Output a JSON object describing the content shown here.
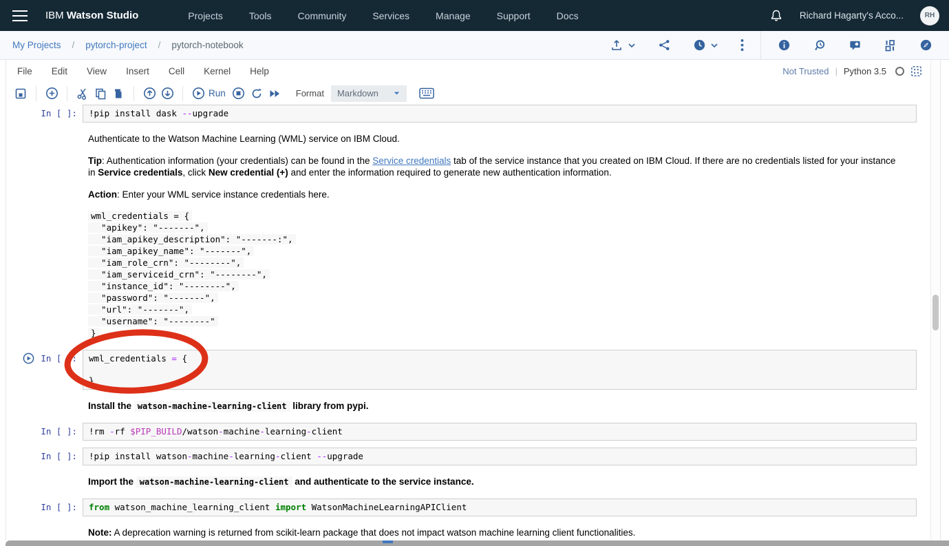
{
  "header": {
    "brand_prefix": "IBM",
    "brand_bold": "Watson Studio",
    "nav": [
      "Projects",
      "Tools",
      "Community",
      "Services",
      "Manage",
      "Support",
      "Docs"
    ],
    "account_name": "Richard Hagarty's Acco...",
    "avatar_initials": "RH",
    "icons": [
      "menu",
      "notifications"
    ]
  },
  "projectbar": {
    "breadcrumb": [
      {
        "label": "My Projects",
        "link": true
      },
      {
        "label": "pytorch-project",
        "link": true
      },
      {
        "label": "pytorch-notebook",
        "link": false
      }
    ],
    "separator": "/",
    "action_icons": [
      "upload",
      "share",
      "versions",
      "overflow-menu",
      "info",
      "history",
      "comments",
      "environment",
      "guide"
    ]
  },
  "menubar": {
    "items": [
      "File",
      "Edit",
      "View",
      "Insert",
      "Cell",
      "Kernel",
      "Help"
    ],
    "trust_label": "Not Trusted",
    "pipe": "|",
    "kernel_name": "Python 3.5",
    "status_icons": [
      "kernel-idle-circle",
      "kernel-busy-grid"
    ]
  },
  "toolbar": {
    "icons": [
      "save",
      "insert-cell",
      "cut",
      "copy",
      "paste",
      "move-up",
      "move-down",
      "run",
      "stop",
      "restart",
      "fast-forward",
      "keyboard"
    ],
    "run_label": "Run",
    "format_label": "Format",
    "format_value": "Markdown"
  },
  "colors": {
    "appbar_bg": "#152935",
    "icon_blue": "#35639f",
    "link_blue": "#4178be",
    "prompt_navy": "#303F9F",
    "operator_purple": "#AA22FF",
    "keyword_green": "#008000",
    "annotation_red": "#dd3018",
    "cell_bg": "#f7f7f7"
  },
  "notebook": {
    "blocks": [
      {
        "kind": "code",
        "prompt": "In [ ]:",
        "lines": [
          [
            {
              "t": "!pip install dask ",
              "s": "p"
            },
            {
              "t": "--",
              "s": "op"
            },
            {
              "t": "upgrade",
              "s": "p"
            }
          ]
        ]
      },
      {
        "kind": "md",
        "runs": [
          {
            "t": "Authenticate to the Watson Machine Learning (WML) service on IBM Cloud."
          }
        ]
      },
      {
        "kind": "md",
        "runs": [
          {
            "t": "Tip",
            "b": true
          },
          {
            "t": ": Authentication information (your credentials) can be found in the "
          },
          {
            "t": "Service credentials",
            "link": true
          },
          {
            "t": " tab of the service instance that you created on IBM Cloud. If there are no credentials listed for your instance in "
          },
          {
            "t": "Service credentials",
            "b": true
          },
          {
            "t": ", click "
          },
          {
            "t": "New credential (+)",
            "b": true
          },
          {
            "t": " and enter the information required to generate new authentication information."
          }
        ]
      },
      {
        "kind": "md",
        "runs": [
          {
            "t": "Action",
            "b": true
          },
          {
            "t": ": Enter your WML service instance credentials here."
          }
        ]
      },
      {
        "kind": "mdcode",
        "lines": [
          "wml_credentials = {",
          "  \"apikey\": \"-------\",",
          "  \"iam_apikey_description\": \"-------:\",",
          "  \"iam_apikey_name\": \"-------\",",
          "  \"iam_role_crn\": \"--------\",",
          "  \"iam_serviceid_crn\": \"--------\",",
          "  \"instance_id\": \"--------\",",
          "  \"password\": \"-------\",",
          "  \"url\": \"-------\",",
          "  \"username\": \"--------\"",
          "}"
        ]
      },
      {
        "kind": "code",
        "prompt": "In [ ]:",
        "circled": true,
        "runbtn": true,
        "lines": [
          [
            {
              "t": "wml_credentials ",
              "s": "p"
            },
            {
              "t": "=",
              "s": "op"
            },
            {
              "t": " {",
              "s": "p"
            }
          ],
          [],
          [
            {
              "t": "}",
              "s": "p"
            }
          ]
        ]
      },
      {
        "kind": "md",
        "runs": [
          {
            "t": "Install the ",
            "b": true
          },
          {
            "t": "watson-machine-learning-client",
            "code": true,
            "b": true
          },
          {
            "t": " library from pypi.",
            "b": true
          }
        ]
      },
      {
        "kind": "code",
        "prompt": "In [ ]:",
        "lines": [
          [
            {
              "t": "!rm ",
              "s": "p"
            },
            {
              "t": "-",
              "s": "op"
            },
            {
              "t": "rf ",
              "s": "p"
            },
            {
              "t": "$PIP_BUILD",
              "s": "env"
            },
            {
              "t": "/watson",
              "s": "p"
            },
            {
              "t": "-",
              "s": "op"
            },
            {
              "t": "machine",
              "s": "p"
            },
            {
              "t": "-",
              "s": "op"
            },
            {
              "t": "learning",
              "s": "p"
            },
            {
              "t": "-",
              "s": "op"
            },
            {
              "t": "client",
              "s": "p"
            }
          ]
        ]
      },
      {
        "kind": "code",
        "prompt": "In [ ]:",
        "lines": [
          [
            {
              "t": "!pip install watson",
              "s": "p"
            },
            {
              "t": "-",
              "s": "op"
            },
            {
              "t": "machine",
              "s": "p"
            },
            {
              "t": "-",
              "s": "op"
            },
            {
              "t": "learning",
              "s": "p"
            },
            {
              "t": "-",
              "s": "op"
            },
            {
              "t": "client ",
              "s": "p"
            },
            {
              "t": "--",
              "s": "op"
            },
            {
              "t": "upgrade",
              "s": "p"
            }
          ]
        ]
      },
      {
        "kind": "md",
        "runs": [
          {
            "t": "Import the ",
            "b": true
          },
          {
            "t": "watson-machine-learning-client",
            "code": true,
            "b": true
          },
          {
            "t": " and authenticate to the service instance.",
            "b": true
          }
        ]
      },
      {
        "kind": "code",
        "prompt": "In [ ]:",
        "lines": [
          [
            {
              "t": "from",
              "s": "kw"
            },
            {
              "t": " watson_machine_learning_client ",
              "s": "p"
            },
            {
              "t": "import",
              "s": "kw"
            },
            {
              "t": " WatsonMachineLearningAPIClient",
              "s": "p"
            }
          ]
        ]
      },
      {
        "kind": "md",
        "runs": [
          {
            "t": "Note:",
            "b": true
          },
          {
            "t": " A deprecation warning is returned from scikit-learn package that does not impact watson machine learning client functionalities."
          }
        ]
      }
    ]
  }
}
